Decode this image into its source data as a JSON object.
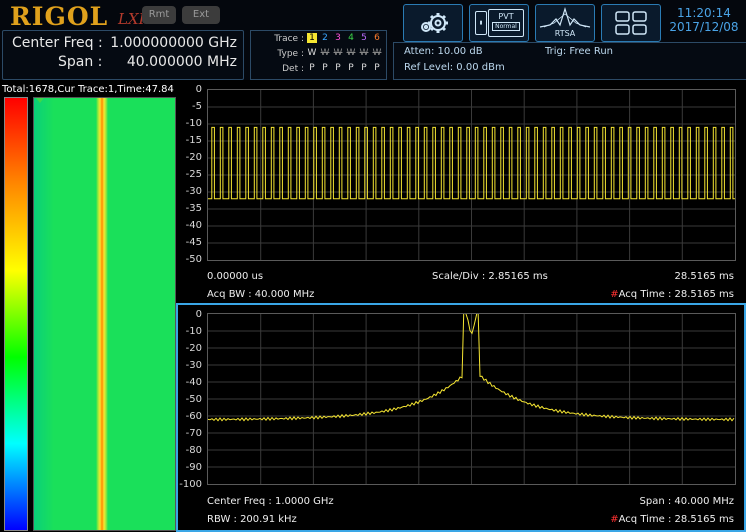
{
  "header": {
    "logo": "RIGOL",
    "lxi": "LXI",
    "rmt_label": "Rmt",
    "ext_label": "Ext",
    "clock_time": "11:20:14",
    "clock_date": "2017/12/08"
  },
  "freq": {
    "center_label": "Center Freq :",
    "center_value": "1.000000000 GHz",
    "span_label": "Span :",
    "span_value": "40.000000 MHz"
  },
  "trace_panel": {
    "trace_label": "Trace :",
    "type_label": "Type :",
    "det_label": "Det :",
    "numbers": [
      "1",
      "2",
      "3",
      "4",
      "5",
      "6"
    ],
    "number_colors": [
      "#f6e632",
      "#3aa6ff",
      "#ff4fd8",
      "#3cd84a",
      "#b86cff",
      "#ff7a2a"
    ],
    "types": [
      "W",
      "W",
      "W",
      "W",
      "W",
      "W"
    ],
    "dets": [
      "P",
      "P",
      "P",
      "P",
      "P",
      "P"
    ]
  },
  "status": {
    "atten": "Atten: 10.00 dB",
    "ref_level": "Ref Level: 0.00 dBm",
    "trig": "Trig: Free Run"
  },
  "modes": {
    "settings_icon": "gear-icon",
    "pvt_label": "PVT",
    "pvt_sub": "Normal",
    "rtsa_label": "RTSA",
    "layout_icon": "grid-icon"
  },
  "spectrogram": {
    "info": "Total:1678,Cur Trace:1,Time:47.84",
    "color_scale": [
      "#ff0000",
      "#ff8800",
      "#ffff00",
      "#00ff00",
      "#00ffff",
      "#0000ff"
    ]
  },
  "pvt_plot": {
    "y_ticks": [
      "0",
      "-5",
      "-10",
      "-15",
      "-20",
      "-25",
      "-30",
      "-35",
      "-40",
      "-45",
      "-50"
    ],
    "start_time": "0.00000 us",
    "scale_div": "Scale/Div : 2.85165 ms",
    "end_time": "28.5165 ms",
    "acq_bw": "Acq BW : 40.000 MHz",
    "acq_time_marker": "#",
    "acq_time": "Acq Time : 28.5165 ms",
    "trace_color": "#f6e632",
    "pulse_count": 62,
    "pulse_high_db": -11,
    "pulse_low_db": -32
  },
  "spectrum_plot": {
    "y_ticks": [
      "0",
      "-10",
      "-20",
      "-30",
      "-40",
      "-50",
      "-60",
      "-70",
      "-80",
      "-90",
      "-100"
    ],
    "center_freq": "Center Freq : 1.0000 GHz",
    "span": "Span : 40.000 MHz",
    "rbw": "RBW : 200.91 kHz",
    "acq_time_marker": "#",
    "acq_time": "Acq Time : 28.5165 ms",
    "trace_color": "#f6e632",
    "peak_db": -13,
    "floor_db": -62
  }
}
